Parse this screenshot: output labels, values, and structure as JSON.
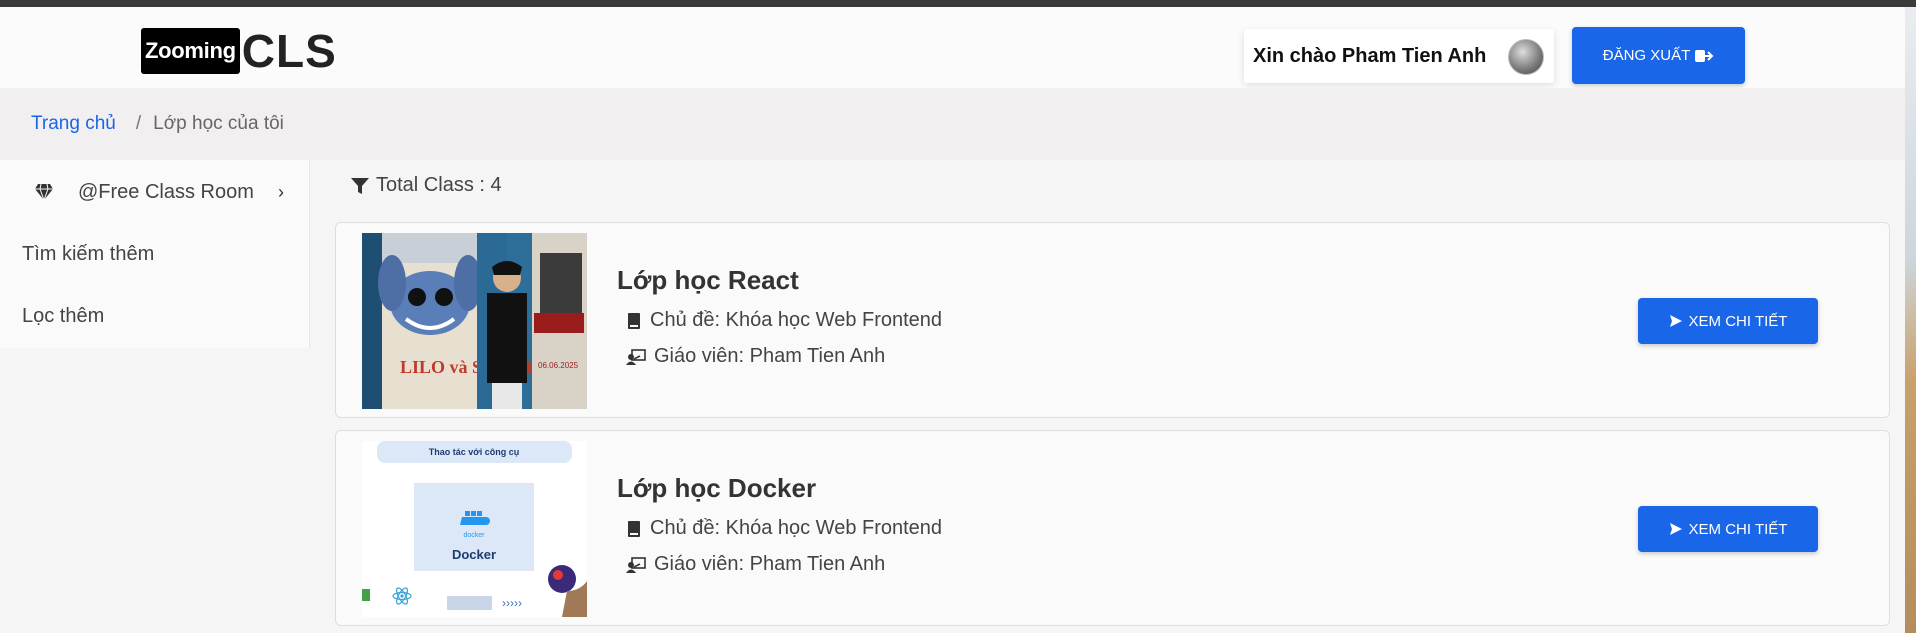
{
  "header": {
    "logo_box": "Zooming",
    "logo_text": "CLS",
    "greeting": "Xin chào Pham Tien Anh",
    "logout_label": "ĐĂNG XUẤT"
  },
  "breadcrumb": {
    "home": "Trang chủ",
    "separator": "/",
    "current": "Lớp học của tôi"
  },
  "sidebar": {
    "items": [
      {
        "label": "@Free Class Room",
        "icon": "diamond-icon"
      },
      {
        "label": "Tìm kiếm thêm"
      },
      {
        "label": "Lọc thêm"
      }
    ]
  },
  "summary": {
    "total_label": "Total Class : 4"
  },
  "classes": [
    {
      "title": "Lớp học React",
      "topic": "Chủ đề: Khóa học Web Frontend",
      "teacher": "Giáo viên: Pham Tien Anh",
      "button": "XEM CHI TIẾT",
      "thumb_poster_title": "LILO và STITCH",
      "thumb_date": "06.06.2025"
    },
    {
      "title": "Lớp học Docker",
      "topic": "Chủ đề: Khóa học Web Frontend",
      "teacher": "Giáo viên: Pham Tien Anh",
      "button": "XEM CHI TIẾT",
      "thumb_header": "Thao tác với công cụ",
      "thumb_small_logo": "docker",
      "thumb_label": "Docker",
      "thumb_arrows": "›››››"
    }
  ],
  "colors": {
    "primary": "#1a66e8",
    "topbar": "#3a3a3a",
    "breadcrumb_bg": "#f1eff0"
  }
}
